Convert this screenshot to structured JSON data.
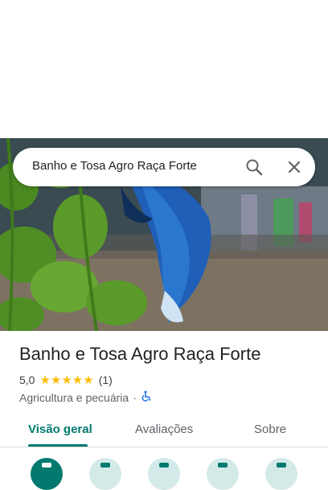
{
  "search": {
    "query": "Banho e Tosa Agro Raça Forte"
  },
  "place": {
    "name": "Banho e Tosa Agro Raça Forte",
    "rating": "5,0",
    "stars": "★★★★★",
    "review_count": "(1)",
    "category": "Agricultura e pecuária",
    "separator": "·"
  },
  "tabs": [
    {
      "label": "Visão geral"
    },
    {
      "label": "Avaliações"
    },
    {
      "label": "Sobre"
    }
  ],
  "icons": {
    "search": "search-icon",
    "close": "close-icon",
    "accessibility": "wheelchair-icon"
  },
  "colors": {
    "accent": "#01796f",
    "stars": "#fbbc04",
    "action_bg": "#d3eae8",
    "accessibility": "#1a73e8"
  }
}
